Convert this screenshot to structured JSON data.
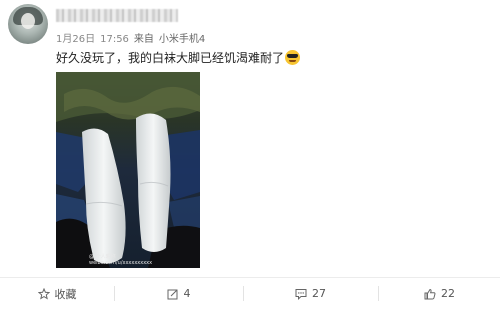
{
  "post": {
    "date": "1月26日",
    "time": "17:56",
    "source_prefix": "来自",
    "source_device": "小米手机4",
    "text": "好久没玩了，我的白袜大脚已经饥渴难耐了",
    "emoji_icon": "cool-sunglasses-emoji"
  },
  "photo": {
    "watermark_line1": "@ 个人昵称",
    "watermark_line2": "weibo.com/u/xxxxxxxxxx"
  },
  "actions": {
    "favorite": {
      "label": "收藏",
      "icon": "star-icon"
    },
    "repost": {
      "count": "4",
      "icon": "repost-icon"
    },
    "comment": {
      "count": "27",
      "icon": "comment-icon"
    },
    "like": {
      "count": "22",
      "icon": "thumbs-up-icon"
    }
  },
  "colors": {
    "text": "#222222",
    "meta": "#888888",
    "action": "#555555"
  }
}
